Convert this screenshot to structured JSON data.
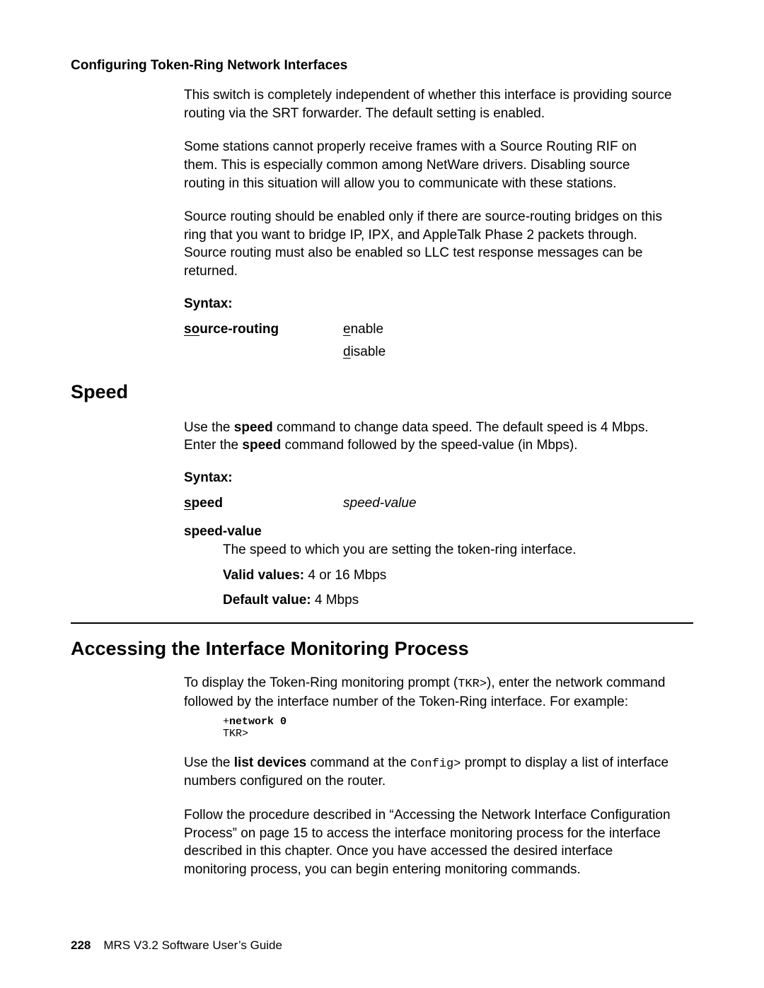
{
  "header": {
    "title": "Configuring Token-Ring Network Interfaces"
  },
  "sourceRouting": {
    "para1": "This switch is completely independent of whether this interface is providing source routing via the SRT forwarder. The default setting is enabled.",
    "para2": "Some stations cannot properly receive frames with a Source Routing RIF on them. This is especially common among NetWare drivers. Disabling source routing in this situation will allow you to communicate with these stations.",
    "para3": "Source routing should be enabled only if there are source-routing bridges on this ring that you want to bridge IP, IPX, and AppleTalk Phase 2 packets through. Source routing must also be enabled so LLC test response messages can be returned.",
    "syntaxLabel": "Syntax:",
    "cmd_ul": "so",
    "cmd_rest": "urce-routing",
    "opt1_ul": "e",
    "opt1_rest": "nable",
    "opt2_ul": "d",
    "opt2_rest": "isable"
  },
  "speed": {
    "heading": "Speed",
    "para1a": "Use the ",
    "para1b": "speed",
    "para1c": " command to change data speed. The default speed is 4 Mbps. Enter the ",
    "para1d": "speed",
    "para1e": " command followed by the speed-value (in Mbps).",
    "syntaxLabel": "Syntax:",
    "cmd_ul": "s",
    "cmd_rest": "peed",
    "arg": "speed-value",
    "dl_term": "speed-value",
    "dl_def": "The speed to which you are setting the token-ring interface.",
    "valid_lbl": "Valid values:",
    "valid_val": " 4 or 16 Mbps",
    "default_lbl": "Default value:",
    "default_val": " 4 Mbps"
  },
  "monitoring": {
    "heading": "Accessing the Interface Monitoring Process",
    "para1a": "To display the Token-Ring monitoring prompt (",
    "para1b": "TKR>",
    "para1c": "), enter the network command followed by the interface number of the Token-Ring interface. For example:",
    "code_line1a": "+",
    "code_line1b": "network 0",
    "code_line2": "TKR>",
    "para2a": "Use the ",
    "para2b": "list devices",
    "para2c": " command at the ",
    "para2d": "Config>",
    "para2e": " prompt to display a list of interface numbers configured on the router.",
    "para3": "Follow the procedure described in “Accessing the Network Interface Configuration Process” on page 15  to access the interface monitoring process for the interface described in this chapter. Once you have accessed the desired interface monitoring process, you can begin entering monitoring commands."
  },
  "footer": {
    "page": "228",
    "doc": "MRS V3.2 Software User’s Guide"
  }
}
